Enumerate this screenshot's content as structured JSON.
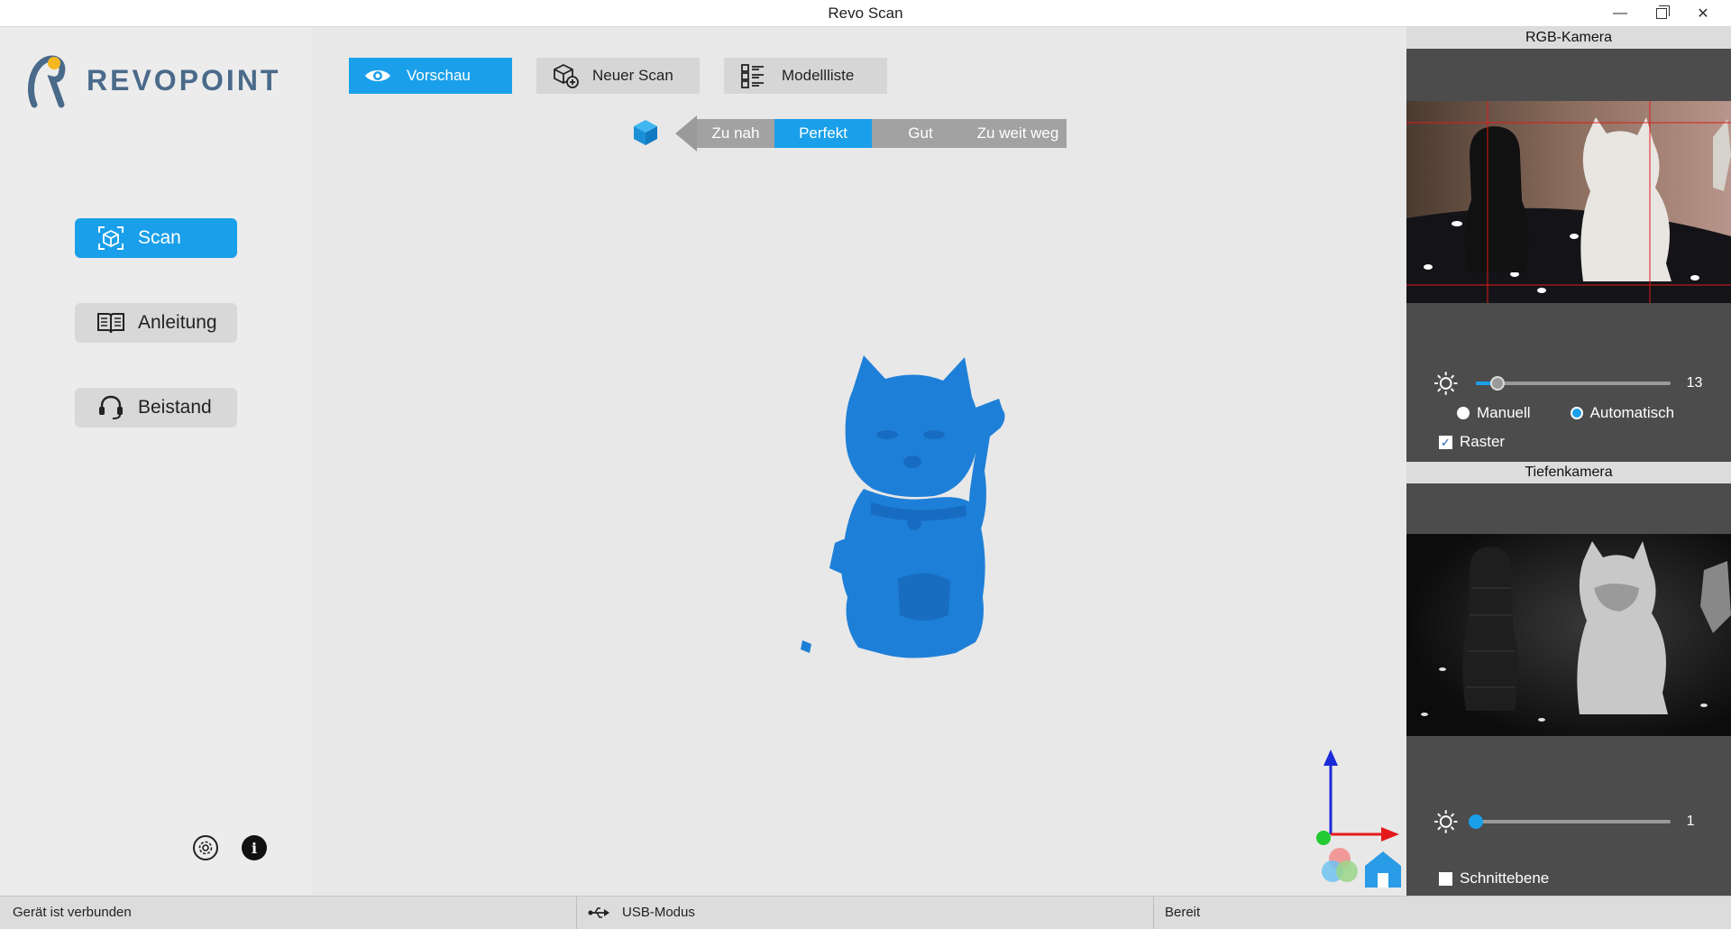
{
  "window": {
    "title": "Revo Scan"
  },
  "sidebar": {
    "brand": "REVOPOINT",
    "items": [
      {
        "label": "Scan",
        "icon": "scan-icon",
        "active": true
      },
      {
        "label": "Anleitung",
        "icon": "book-icon",
        "active": false
      },
      {
        "label": "Beistand",
        "icon": "headset-icon",
        "active": false
      }
    ],
    "footer_icons": [
      "settings-icon",
      "info-icon"
    ]
  },
  "toolbar": {
    "preview_label": "Vorschau",
    "new_scan_label": "Neuer Scan",
    "model_list_label": "Modellliste"
  },
  "distance": {
    "segments": [
      "Zu nah",
      "Perfekt",
      "Gut",
      "Zu weit weg"
    ],
    "active": "Perfekt"
  },
  "right_panel": {
    "rgb_title": "RGB-Kamera",
    "rgb_brightness": "13",
    "rgb_brightness_fraction": 0.11,
    "mode_manual": "Manuell",
    "mode_auto": "Automatisch",
    "selected_mode": "Automatisch",
    "raster_label": "Raster",
    "raster_checked": true,
    "depth_title": "Tiefenkamera",
    "depth_brightness": "1",
    "depth_brightness_fraction": 0.0,
    "cut_plane_label": "Schnittebene",
    "cut_plane_checked": false
  },
  "statusbar": {
    "connection": "Gerät ist verbunden",
    "mode": "USB-Modus",
    "state": "Bereit"
  },
  "colors": {
    "accent": "#1aa0ea",
    "model_blue": "#1e7fd8"
  }
}
